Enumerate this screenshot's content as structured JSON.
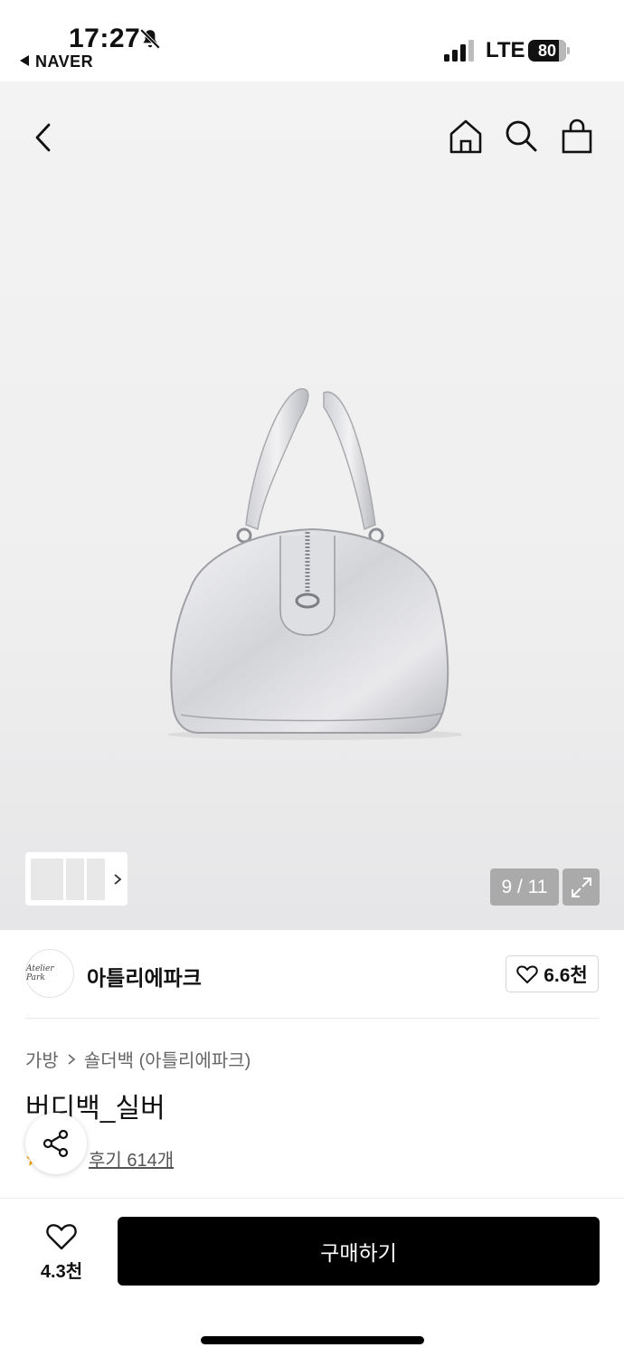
{
  "status_bar": {
    "time": "17:27",
    "back_app": "NAVER",
    "network": "LTE",
    "battery": "80",
    "icons": [
      "bell-slash-icon",
      "signal-icon",
      "battery-icon"
    ]
  },
  "header": {
    "icons": [
      "back-chevron-icon",
      "home-icon",
      "search-icon",
      "shopping-bag-icon"
    ]
  },
  "gallery": {
    "counter": "9 / 11",
    "expand_icon": "expand-icon"
  },
  "store": {
    "logo_text": "Atelier Park",
    "name": "아틀리에파크",
    "favorites": "6.6천"
  },
  "product": {
    "breadcrumb": [
      "가방",
      "숄더백 (아틀리에파크)"
    ],
    "title": "버디백_실버",
    "reviews": "후기 614개"
  },
  "bottom_bar": {
    "wish_count": "4.3천",
    "buy_label": "구매하기"
  },
  "colors": {
    "accent_star": "#f5a300",
    "button_bg": "#000000",
    "hero_bg": "#f0f0f0"
  }
}
